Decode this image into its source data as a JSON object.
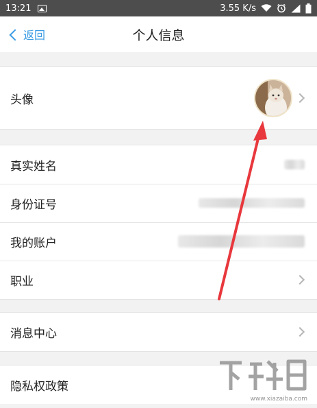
{
  "status_bar": {
    "time": "13:21",
    "network_speed": "3.55 K/s",
    "icons": [
      "image-icon",
      "wifi-icon",
      "alarm-icon",
      "signal-icon",
      "battery-icon"
    ]
  },
  "header": {
    "back_label": "返回",
    "title": "个人信息"
  },
  "sections": {
    "avatar": {
      "label": "头像"
    },
    "info": {
      "real_name_label": "真实姓名",
      "id_number_label": "身份证号",
      "account_label": "我的账户",
      "job_label": "职业"
    },
    "messages": {
      "label": "消息中心"
    },
    "privacy": {
      "label": "隐私权政策"
    }
  },
  "watermark": {
    "text": "下载吧",
    "url": "www.xiazaiba.com"
  },
  "colors": {
    "accent": "#3a9be3",
    "annotation_arrow": "#e8383d",
    "background": "#f2f2f2",
    "status_bar": "#4d4d4d"
  }
}
